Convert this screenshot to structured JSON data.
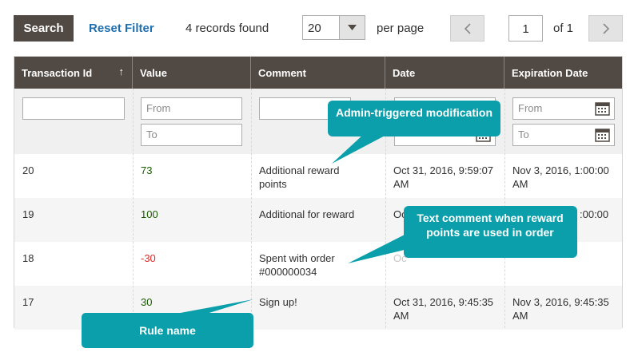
{
  "toolbar": {
    "search_label": "Search",
    "reset_label": "Reset Filter",
    "records_found": "4 records found",
    "per_page_value": "20",
    "per_page_label": "per page",
    "current_page": "1",
    "of_pages": "of 1"
  },
  "table": {
    "columns": [
      "Transaction Id",
      "Value",
      "Comment",
      "Date",
      "Expiration Date"
    ],
    "sort_indicator": "↑",
    "filters": {
      "from_placeholder": "From",
      "to_placeholder": "To"
    },
    "rows": [
      {
        "id": "20",
        "value": "73",
        "comment": "Additional reward points",
        "date": "Oct 31, 2016, 9:59:07 AM",
        "expiration": "Nov 3, 2016, 1:00:00 AM"
      },
      {
        "id": "19",
        "value": "100",
        "comment": "Additional for reward",
        "date": "",
        "expiration": ":00:00"
      },
      {
        "id": "18",
        "value": "-30",
        "comment": "Spent with order #000000034",
        "date": "",
        "expiration": ""
      },
      {
        "id": "17",
        "value": "30",
        "comment": "Sign up!",
        "date": "Oct 31, 2016, 9:45:35 AM",
        "expiration": "Nov 3, 2016, 9:45:35 AM"
      }
    ],
    "partial_texts": {
      "row19_date": "Oc",
      "row18_date": "Oc"
    }
  },
  "callouts": {
    "admin": "Admin-triggered modification",
    "text_comment": "Text comment when reward points are used in order",
    "rule_name": "Rule name"
  },
  "colors": {
    "header_bg": "#514943",
    "link": "#1f6fae",
    "callout": "#0a9fab",
    "positive": "#185b00",
    "negative": "#e22626"
  }
}
